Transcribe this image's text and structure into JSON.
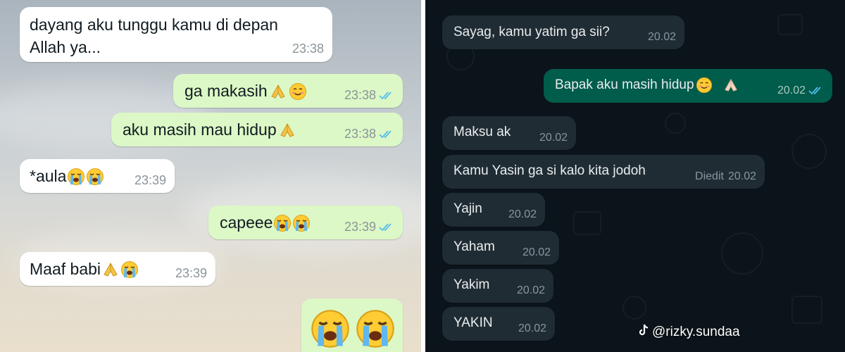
{
  "left_chat": {
    "messages": [
      {
        "text_line1": "dayang aku tunggu kamu di depan",
        "text_line2": "Allah ya...",
        "time": "23:38"
      },
      {
        "text": "ga makasih",
        "time": "23:38"
      },
      {
        "text": "aku masih mau hidup",
        "time": "23:38"
      },
      {
        "text": "*aula",
        "time": "23:39"
      },
      {
        "text": "capeee",
        "time": "23:39"
      },
      {
        "text": "Maaf babi",
        "time": "23:39"
      }
    ]
  },
  "right_chat": {
    "messages": [
      {
        "text": "Sayag, kamu yatim ga sii?",
        "time": "20.02"
      },
      {
        "text": "Bapak aku masih hidup",
        "time": "20.02"
      },
      {
        "text": "Maksu ak",
        "time": "20.02"
      },
      {
        "text": "Kamu Yasin ga si kalo kita jodoh",
        "edited": "Diedit",
        "time": "20.02"
      },
      {
        "text": "Yajin",
        "time": "20.02"
      },
      {
        "text": "Yaham",
        "time": "20.02"
      },
      {
        "text": "Yakim",
        "time": "20.02"
      },
      {
        "text": "YAKIN",
        "time": "20.02"
      }
    ],
    "watermark": "@rizky.sundaa"
  },
  "icons": {
    "read_receipt": "double-check-icon",
    "tiktok": "tiktok-icon",
    "emojis": [
      "folded-hands-emoji",
      "smiling-face-emoji",
      "loudly-crying-face-emoji"
    ]
  },
  "colors": {
    "light_incoming": "#ffffff",
    "light_outgoing": "#dcf8c6",
    "dark_background": "#0b141a",
    "dark_incoming": "#202c33",
    "dark_outgoing": "#005c4b",
    "read_tick": "#53bdeb"
  }
}
